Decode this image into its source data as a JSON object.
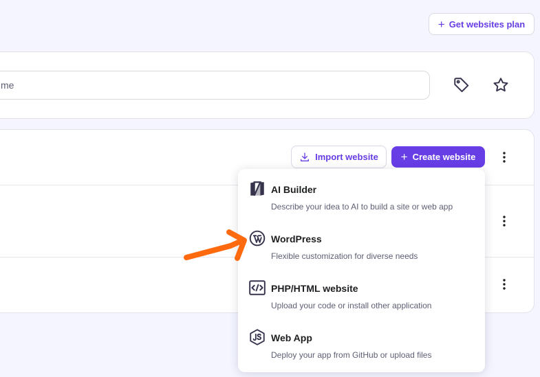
{
  "header": {
    "plan_button": "Get websites plan"
  },
  "search": {
    "value": "me"
  },
  "toolbar": {
    "import_label": "Import website",
    "create_label": "Create website"
  },
  "create_menu": {
    "items": [
      {
        "title": "AI Builder",
        "description": "Describe your idea to AI to build a site or web app",
        "icon": "ai-builder-icon"
      },
      {
        "title": "WordPress",
        "description": "Flexible customization for diverse needs",
        "icon": "wordpress-icon"
      },
      {
        "title": "PHP/HTML website",
        "description": "Upload your code or install other application",
        "icon": "code-icon"
      },
      {
        "title": "Web App",
        "description": "Deploy your app from GitHub or upload files",
        "icon": "nodejs-icon"
      }
    ]
  },
  "colors": {
    "accent": "#673de6",
    "annotation_arrow": "#ff6a0f",
    "background": "#f4f5ff"
  }
}
